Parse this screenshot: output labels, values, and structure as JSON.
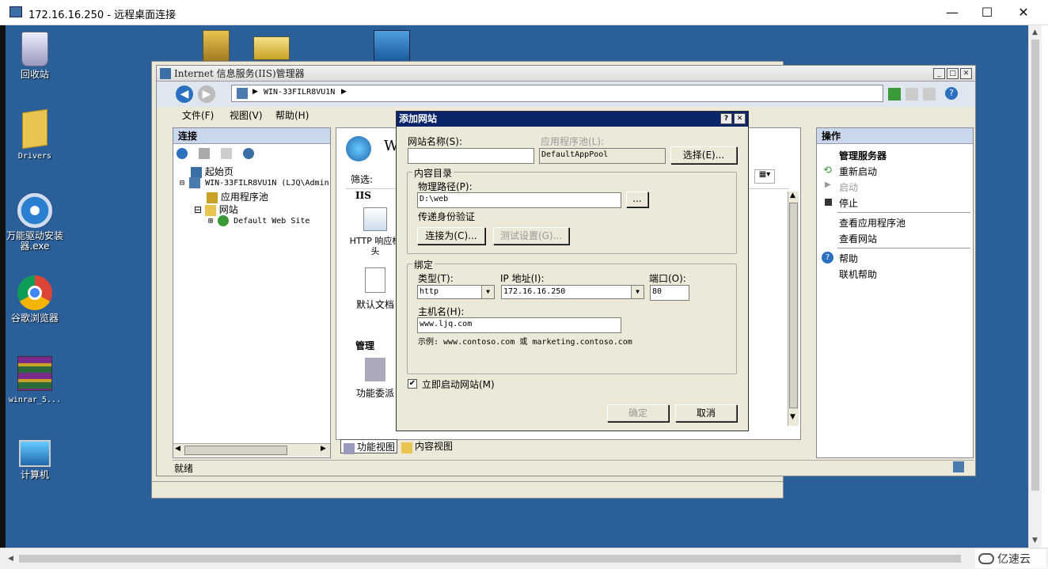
{
  "rdp": {
    "title": "172.16.16.250 - 远程桌面连接",
    "minimize": "—",
    "maximize": "☐",
    "close": "✕"
  },
  "desktop": {
    "icons": [
      {
        "label": "回收站"
      },
      {
        "label": "Drivers"
      },
      {
        "label": "万能驱动安装器.exe"
      },
      {
        "label": "谷歌浏览器"
      },
      {
        "label": "winrar_5..."
      },
      {
        "label": "计算机"
      }
    ]
  },
  "iis": {
    "title": "Internet 信息服务(IIS)管理器",
    "address": "WIN-33FILR8VU1N",
    "menu": {
      "file": "文件(F)",
      "view": "视图(V)",
      "help": "帮助(H)"
    },
    "connections": {
      "header": "连接",
      "tree": {
        "start": "起始页",
        "server": "WIN-33FILR8VU1N (LJQ\\Admin",
        "app_pools": "应用程序池",
        "sites": "网站",
        "default_site": "Default Web Site"
      }
    },
    "center": {
      "title_partial": "WI",
      "filter_label": "筛选:",
      "section_iis": "IIS",
      "http_headers": "HTTP 响应标头",
      "default_doc": "默认文档",
      "section_manage": "管理",
      "delegation": "功能委派",
      "features_view": "功能视图",
      "content_view": "内容视图"
    },
    "actions": {
      "header": "操作",
      "manage_server": "管理服务器",
      "restart": "重新启动",
      "start": "启动",
      "stop": "停止",
      "view_app_pools": "查看应用程序池",
      "view_sites": "查看网站",
      "help": "帮助",
      "online_help": "联机帮助"
    },
    "status": "就绪"
  },
  "dialog": {
    "title": "添加网站",
    "help_btn": "?",
    "close_btn": "✕",
    "site_name_label": "网站名称(S):",
    "site_name_value": "",
    "app_pool_label": "应用程序池(L):",
    "app_pool_value": "DefaultAppPool",
    "select_button": "选择(E)...",
    "content_dir_legend": "内容目录",
    "physical_path_label": "物理路径(P):",
    "physical_path_value": "D:\\web",
    "browse_button": "...",
    "passthrough_label": "传递身份验证",
    "connect_as_button": "连接为(C)...",
    "test_settings_button": "测试设置(G)...",
    "binding_legend": "绑定",
    "type_label": "类型(T):",
    "type_value": "http",
    "ip_label": "IP 地址(I):",
    "ip_value": "172.16.16.250",
    "port_label": "端口(O):",
    "port_value": "80",
    "hostname_label": "主机名(H):",
    "hostname_value": "www.ljq.com",
    "example_text": "示例: www.contoso.com 或 marketing.contoso.com",
    "start_immediately_label": "立即启动网站(M)",
    "start_immediately_checked": true,
    "ok_button": "确定",
    "cancel_button": "取消"
  },
  "watermark": "亿速云"
}
